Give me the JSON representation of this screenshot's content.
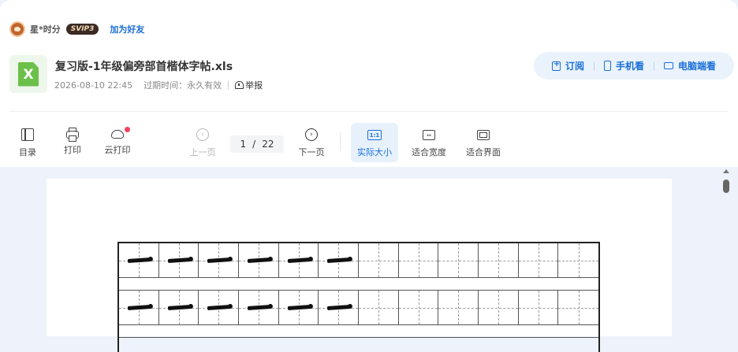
{
  "user": {
    "name": "星*时分",
    "vip_badge": "SVIP3",
    "add_friend": "加为好友"
  },
  "file": {
    "icon": "excel-file-icon",
    "icon_letter": "X",
    "title": "复习版-1年级偏旁部首楷体字帖.xls",
    "date": "2026-08-10 22:45",
    "expire": "过期时间：永久有效",
    "report": "举报"
  },
  "actions": {
    "subscribe": "订阅",
    "phone": "手机看",
    "pc": "电脑端看"
  },
  "toolbar": {
    "catalog": "目录",
    "print": "打印",
    "cloud_print": "云打印",
    "prev": "上一页",
    "current_page": "1",
    "total_pages": "22",
    "next": "下一页",
    "actual_size": "实际大小",
    "actual_size_icon": "1:1",
    "fit_width": "适合宽度",
    "fit_page": "适合界面"
  },
  "colors": {
    "accent": "#1a6fd8",
    "notify_dot": "#f0445d",
    "excel_green": "#6cc04a"
  }
}
